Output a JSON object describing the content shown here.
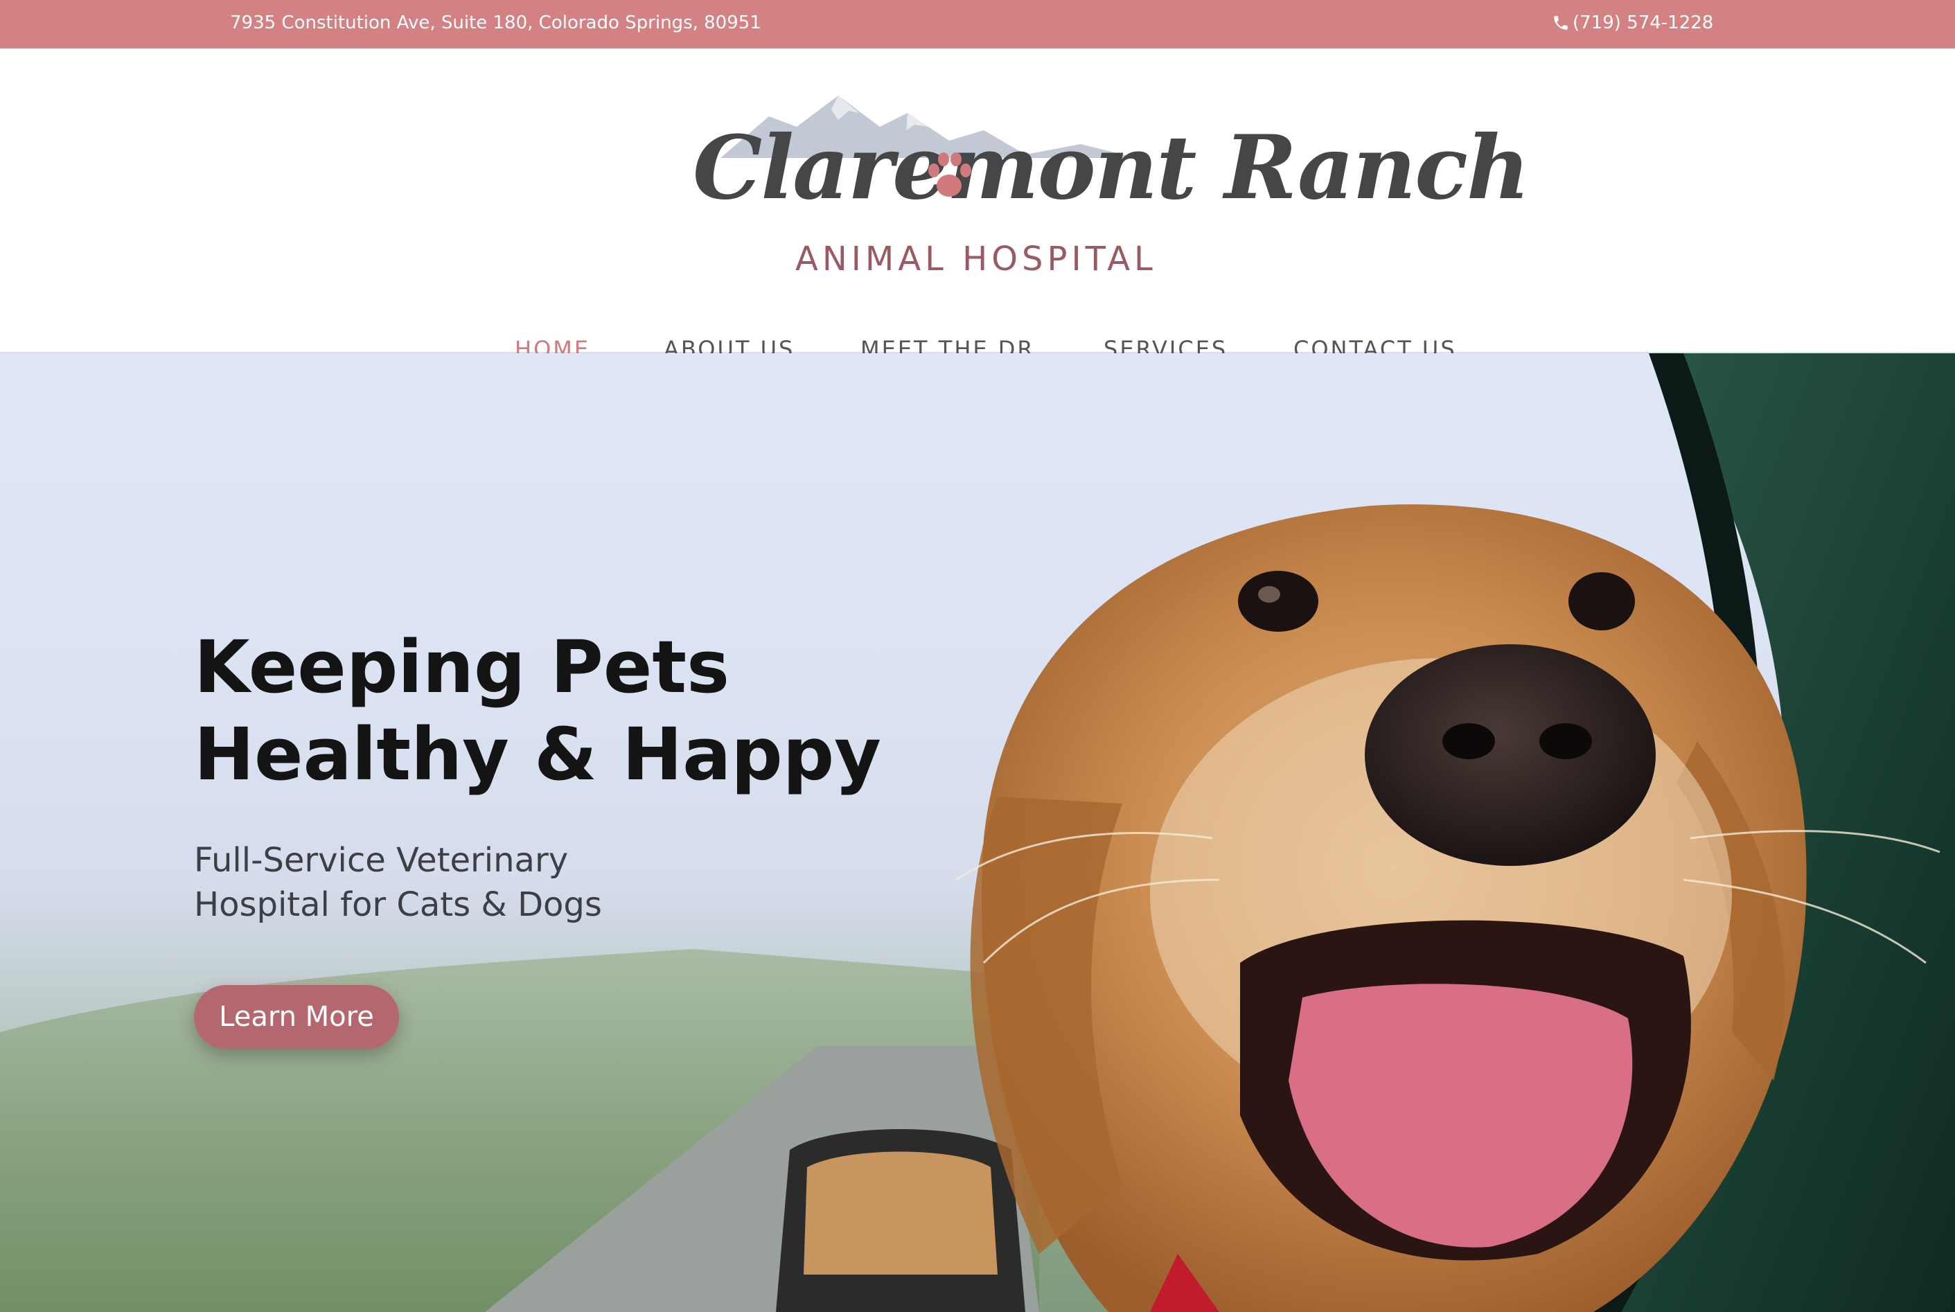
{
  "topbar": {
    "address": "7935 Constitution Ave, Suite 180, Colorado Springs, 80951",
    "phone": "(719) 574-1228",
    "phone_icon": "phone-icon"
  },
  "logo": {
    "name": "Claremont Ranch",
    "subtitle": "ANIMAL HOSPITAL",
    "icons": [
      "mountains-graphic",
      "paw-icon"
    ]
  },
  "nav": {
    "items": [
      {
        "label": "HOME",
        "active": true
      },
      {
        "label": "ABOUT US",
        "active": false
      },
      {
        "label": "MEET THE DR.",
        "active": false
      },
      {
        "label": "SERVICES",
        "active": false
      },
      {
        "label": "CONTACT US",
        "active": false
      }
    ]
  },
  "hero": {
    "headline_line1": "Keeping Pets",
    "headline_line2": "Healthy & Happy",
    "subline_line1": "Full-Service Veterinary",
    "subline_line2": "Hospital for Cats & Dogs",
    "cta_label": "Learn More"
  },
  "colors": {
    "topbar": "#d48184",
    "nav_active": "#d07a7e",
    "nav_text": "#555555",
    "logo_script": "#444648",
    "logo_subtitle": "#9b5a62",
    "cta": "#b56770"
  }
}
